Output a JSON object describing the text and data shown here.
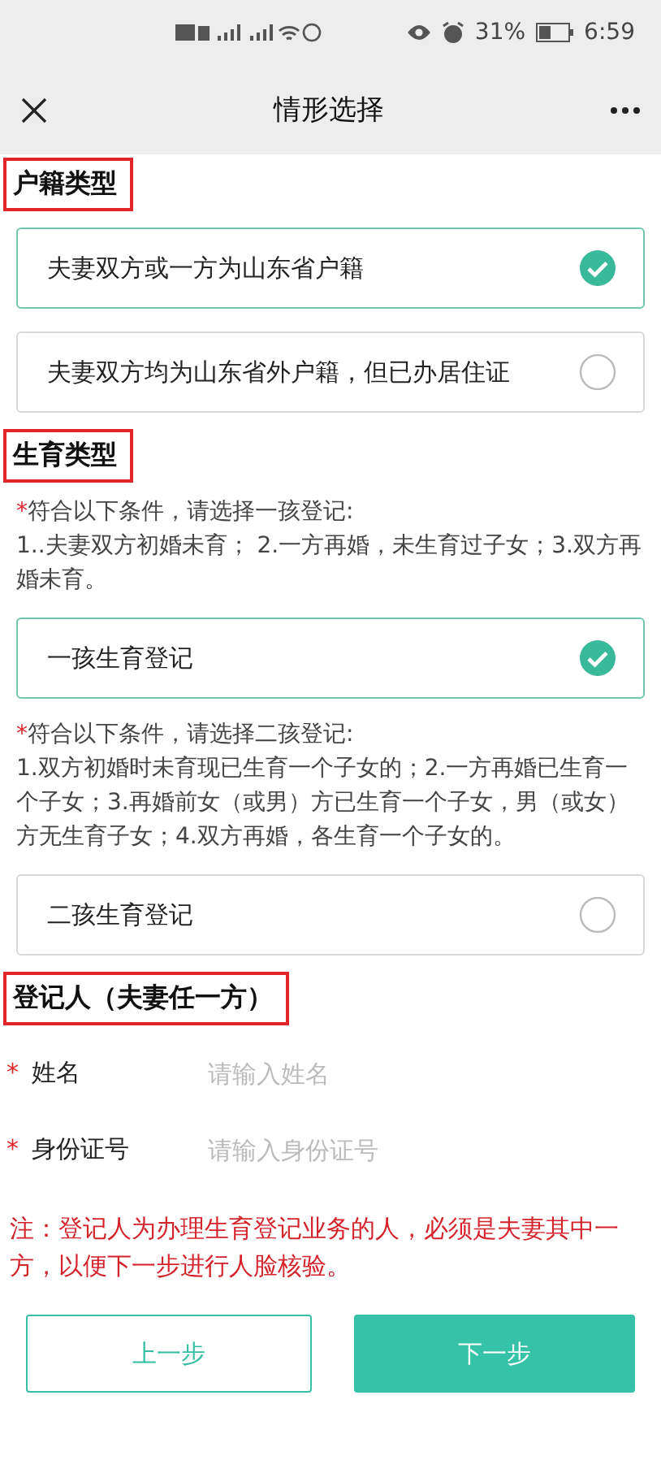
{
  "status_bar": {
    "battery": "31%",
    "time": "6:59"
  },
  "nav": {
    "title": "情形选择"
  },
  "blocks": [
    {
      "kind": "heading",
      "text": "户籍类型"
    },
    {
      "kind": "option",
      "label": "夫妻双方或一方为山东省户籍",
      "selected": true
    },
    {
      "kind": "option",
      "label": "夫妻双方均为山东省外户籍，但已办居住证",
      "selected": false
    },
    {
      "kind": "heading",
      "text": "生育类型"
    },
    {
      "kind": "note",
      "mark": "*",
      "title": "符合以下条件，请选择一孩登记:",
      "text": "1..夫妻双方初婚未育； 2.一方再婚，未生育过子女；3.双方再婚未育。"
    },
    {
      "kind": "option",
      "label": "一孩生育登记",
      "selected": true
    },
    {
      "kind": "note",
      "mark": "*",
      "title": "符合以下条件，请选择二孩登记:",
      "text": "1.双方初婚时未育现已生育一个子女的；2.一方再婚已生育一个子女；3.再婚前女（或男）方已生育一个子女，男（或女）方无生育子女；4.双方再婚，各生育一个子女的。"
    },
    {
      "kind": "option",
      "label": "二孩生育登记",
      "selected": false
    },
    {
      "kind": "heading",
      "text": "登记人（夫妻任一方）"
    },
    {
      "kind": "field",
      "mark": "*",
      "label": "姓名",
      "placeholder": "请输入姓名"
    },
    {
      "kind": "field",
      "mark": "*",
      "label": "身份证号",
      "placeholder": "请输入身份证号"
    },
    {
      "kind": "warning",
      "text": "注：登记人为办理生育登记业务的人，必须是夫妻其中一方，以便下一步进行人脸核验。"
    }
  ],
  "buttons": [
    {
      "kind": "secondary",
      "label": "上一步"
    },
    {
      "kind": "primary",
      "label": "下一步"
    }
  ]
}
